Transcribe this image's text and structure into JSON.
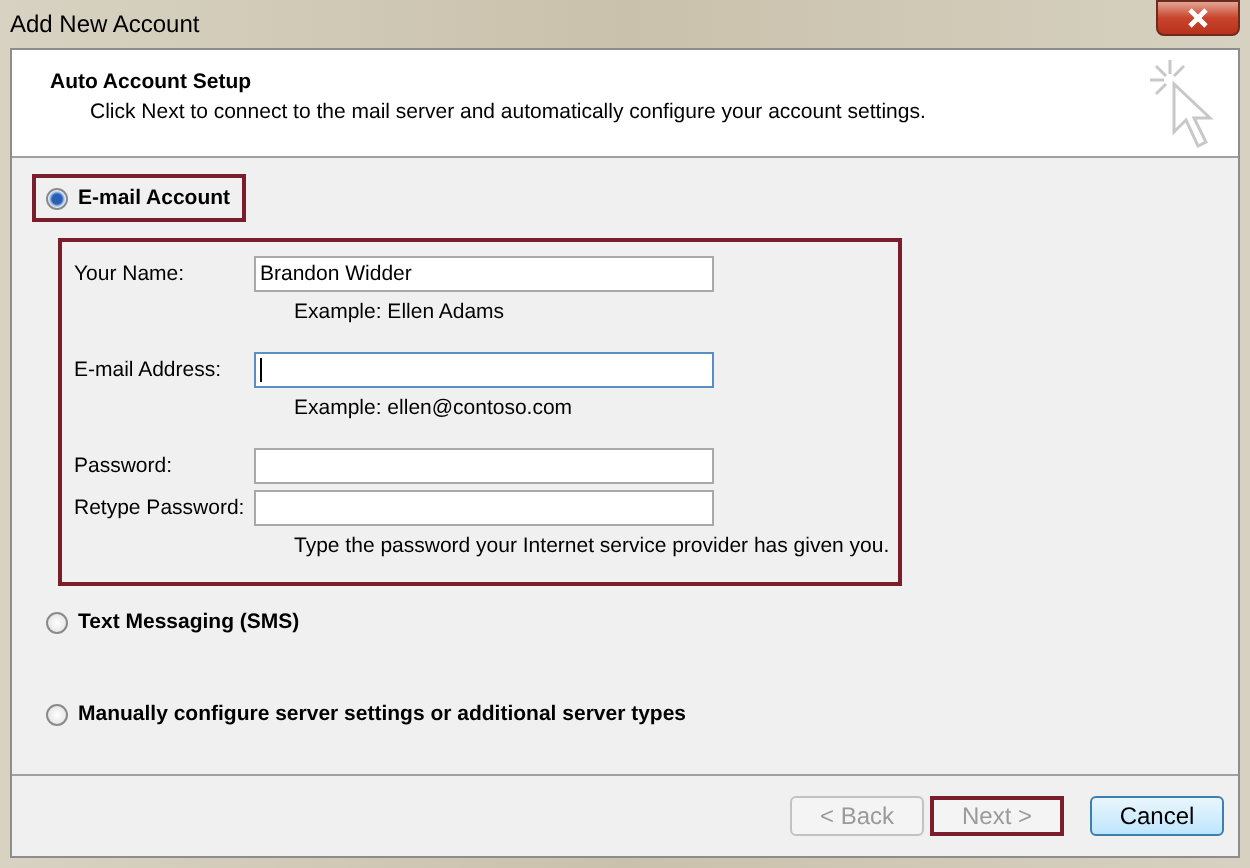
{
  "window": {
    "title": "Add New Account"
  },
  "header": {
    "title": "Auto Account Setup",
    "subtitle": "Click Next to connect to the mail server and automatically configure your account settings."
  },
  "account_types": [
    {
      "label": "E-mail Account",
      "selected": true,
      "highlighted": true
    },
    {
      "label": "Text Messaging (SMS)",
      "selected": false,
      "highlighted": false
    },
    {
      "label": "Manually configure server settings or additional server types",
      "selected": false,
      "highlighted": false
    }
  ],
  "email_form": {
    "highlighted": true,
    "fields": [
      {
        "label": "Your Name:",
        "value": "Brandon Widder",
        "focused": false,
        "hint": "Example: Ellen Adams"
      },
      {
        "label": "E-mail Address:",
        "focused": true,
        "hint": "Example: ellen@contoso.com"
      },
      {
        "label": "Password:",
        "focused": false
      },
      {
        "label": "Retype Password:",
        "focused": false,
        "hint": "Type the password your Internet service provider has given you."
      }
    ]
  },
  "buttons": [
    {
      "label": "< Back",
      "disabled": true,
      "highlighted": false,
      "kind": "secondary"
    },
    {
      "label": "Next >",
      "disabled": true,
      "highlighted": true,
      "kind": "secondary"
    },
    {
      "label": "Cancel",
      "disabled": false,
      "highlighted": false,
      "kind": "default"
    }
  ]
}
